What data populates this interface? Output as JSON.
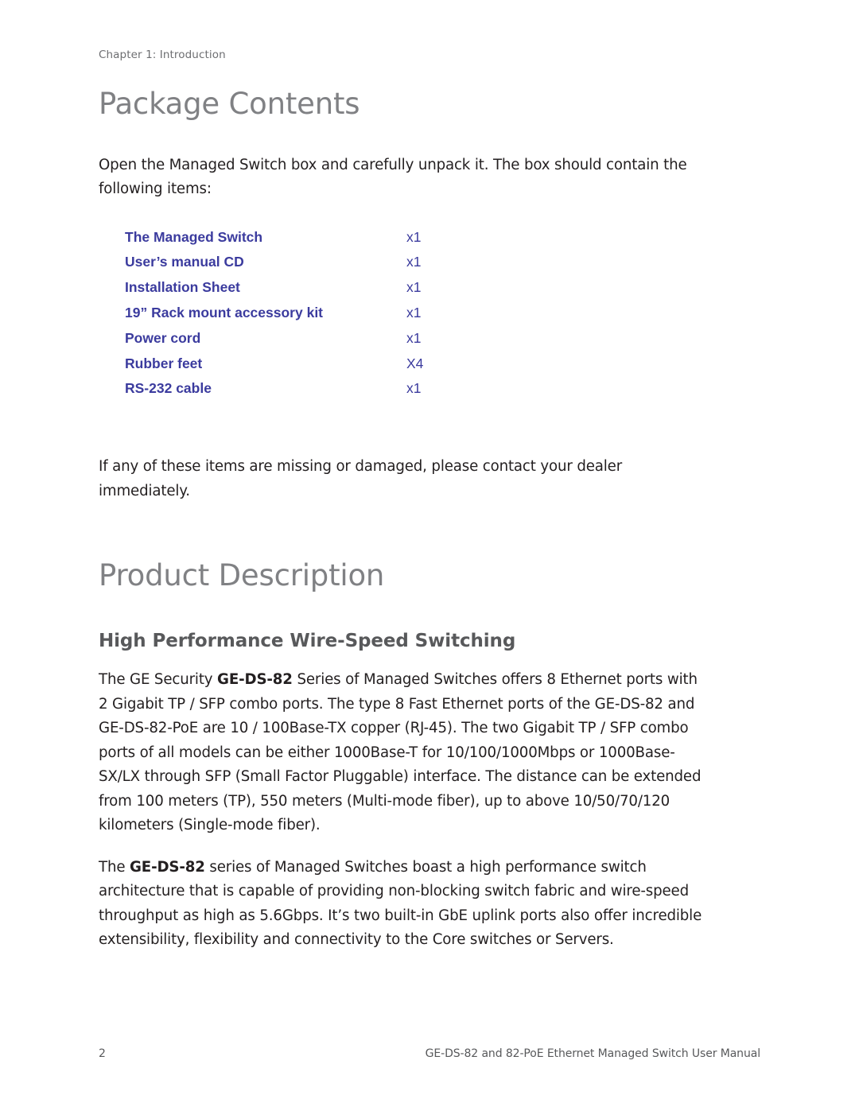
{
  "page": {
    "running_header": "Chapter 1: Introduction",
    "accent_blue": "#3b3b9e",
    "heading_gray": "#808184",
    "subheading_gray": "#58595b",
    "body_color": "#231f20",
    "background": "#ffffff"
  },
  "package_contents": {
    "title": "Package Contents",
    "intro": "Open the Managed Switch box and carefully unpack it. The box should contain the following items:",
    "items": [
      {
        "name": "The Managed Switch",
        "qty": "x1"
      },
      {
        "name": "User’s manual CD",
        "qty": "x1"
      },
      {
        "name": "Installation Sheet",
        "qty": "x1"
      },
      {
        "name": "19” Rack mount accessory kit",
        "qty": "x1"
      },
      {
        "name": "Power cord",
        "qty": "x1"
      },
      {
        "name": "Rubber feet",
        "qty": "X4"
      },
      {
        "name": "RS-232 cable",
        "qty": "x1"
      }
    ],
    "outro": "If any of these items are missing or damaged, please contact your dealer immediately."
  },
  "product_description": {
    "title": "Product Description",
    "subsection_title": "High Performance Wire-Speed Switching",
    "paragraph_1": {
      "lead": "The GE Security ",
      "bold": "GE-DS-82",
      "rest": " Series of Managed Switches offers 8 Ethernet ports with 2 Gigabit TP / SFP combo ports. The type 8 Fast Ethernet ports of the GE-DS-82 and GE-DS-82-PoE are 10 / 100Base-TX copper (RJ-45). The two Gigabit TP / SFP combo ports of all models can be either 1000Base-T for 10/100/1000Mbps or 1000Base-SX/LX through SFP (Small Factor Pluggable) interface. The distance can be extended from 100 meters (TP), 550 meters (Multi-mode fiber), up to above 10/50/70/120 kilometers (Single-mode fiber)."
    },
    "paragraph_2": {
      "lead": "The ",
      "bold": "GE-DS-82",
      "rest": " series of Managed Switches boast a high performance switch architecture that is capable of providing non-blocking switch fabric and wire-speed throughput as high as 5.6Gbps. It’s two built-in GbE uplink ports also offer incredible extensibility, flexibility and connectivity to the Core switches or Servers."
    }
  },
  "footer": {
    "page_number": "2",
    "note": "GE-DS-82 and 82-PoE Ethernet Managed Switch User Manual"
  }
}
